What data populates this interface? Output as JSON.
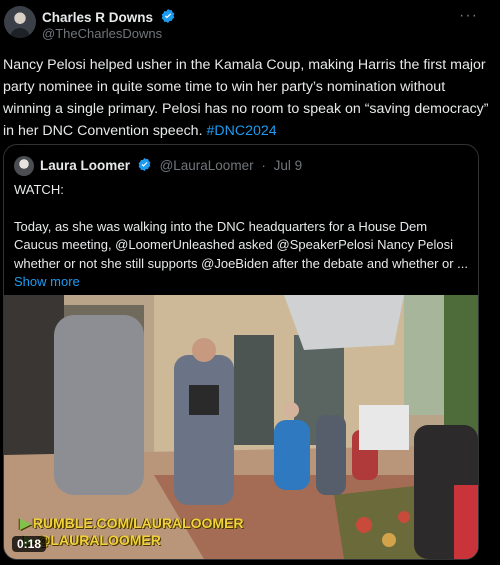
{
  "post": {
    "author_name": "Charles R Downs",
    "author_handle": "@TheCharlesDowns",
    "more_icon": "more-icon",
    "text": "Nancy Pelosi helped usher in the Kamala Coup, making Harris the first major party nominee in quite some time to win her party’s nomination without winning a single primary. Pelosi has no room to speak on “saving democracy” in her DNC Convention speech.",
    "hashtag": "#DNC2024"
  },
  "quote": {
    "author_name": "Laura Loomer",
    "author_handle": "@LauraLoomer",
    "separator": "·",
    "date": "Jul 9",
    "line1": "WATCH:",
    "line2": "Today, as she was walking into the DNC headquarters for a House Dem Caucus meeting, @LoomerUnleashed asked @SpeakerPelosi Nancy Pelosi whether or not she still supports @JoeBiden after the debate and whether or ...",
    "show_more": "Show more",
    "video": {
      "duration": "0:18",
      "watermark_line1": "RUMBLE.COM/LAURALOOMER",
      "watermark_line2": "@LAURALOOMER"
    }
  },
  "colors": {
    "background": "#000000",
    "text": "#e7e9ea",
    "secondary": "#71767b",
    "accent": "#1d9bf0",
    "border": "#2f3336"
  }
}
